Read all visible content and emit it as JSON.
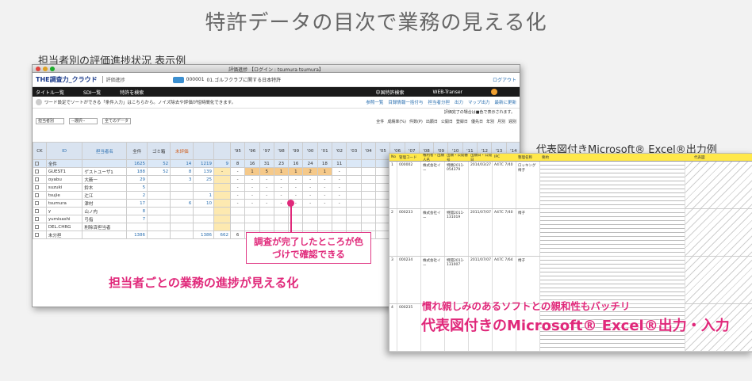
{
  "banner": {
    "title": "特許データの目次で業務の見える化",
    "left_caption": "担当者別の評価進捗状況 表示例",
    "right_caption": "代表図付きMicrosoft® Excel®出力例"
  },
  "window": {
    "title": "評価進捗 【ログイン : tsumura tsumura】",
    "app_logo": "THE調査力_クラウド",
    "page_name": "評価進捗",
    "project_id": "000001",
    "project_name": "01.ゴルフクラブに関する日本特許",
    "logout": "ログアウト"
  },
  "nav": {
    "items": [
      "タイトル一覧",
      "SDI一覧",
      "特許を検索"
    ],
    "right": [
      "中国特許検索",
      "WEB-Transer"
    ]
  },
  "toolbar": {
    "info": "ワード設定でソートができる「条件入力」はこちらから。ノイズ除去や評価が短時間化できます。",
    "tools": [
      "参照一覧",
      "目録情報一括付与",
      "担当者分担",
      "出力",
      "マップ出力",
      "最新に更新"
    ]
  },
  "hint": "評価完了の場合は■色で表示されます。",
  "filters": {
    "s1": "担当者別",
    "s2": "--選択--",
    "s3": "全てのデータ",
    "radios": [
      "全件",
      "成績率(%)",
      "件数(P)",
      "出願日",
      "公開日",
      "登録日",
      "優先日",
      "年別",
      "月別",
      "週別"
    ]
  },
  "table": {
    "headers": [
      "CK",
      "ID",
      "担当者名",
      "全件",
      "ゴミ箱",
      "未評価",
      "",
      "",
      "'95",
      "'96",
      "'97",
      "'98",
      "'99",
      "'00",
      "'01",
      "'02",
      "'03",
      "'04",
      "'05",
      "'06",
      "'07",
      "'08",
      "'09",
      "'10",
      "'11",
      "'12",
      "'13",
      "'14"
    ],
    "rows": [
      [
        "",
        "全件",
        "",
        "1625",
        "52",
        "14",
        "1219",
        "9",
        "8",
        "16",
        "31",
        "23",
        "16",
        "24",
        "18",
        "11",
        "",
        "",
        "",
        "",
        "",
        "",
        "",
        "",
        "",
        "",
        "",
        ""
      ],
      [
        "",
        "GUEST1",
        "ゲストユーザ1",
        "188",
        "52",
        "8",
        "139",
        "-",
        "-",
        "1",
        "5",
        "1",
        "1",
        "2",
        "1",
        "-",
        "",
        "",
        "",
        "",
        "",
        "",
        "",
        "",
        "",
        "",
        "",
        ""
      ],
      [
        "",
        "oyabu",
        "大薮一",
        "29",
        "",
        "3",
        "25",
        "",
        "-",
        "-",
        "-",
        "-",
        "-",
        "-",
        "-",
        "-",
        "",
        "",
        "",
        "",
        "",
        "",
        "",
        "",
        "",
        "",
        "",
        ""
      ],
      [
        "",
        "suzuki",
        "鈴木",
        "5",
        "",
        "",
        "",
        "",
        "-",
        "-",
        "-",
        "-",
        "-",
        "-",
        "-",
        "-",
        "",
        "",
        "",
        "",
        "",
        "",
        "",
        "",
        "",
        "",
        "",
        ""
      ],
      [
        "",
        "tsujie",
        "辻江",
        "2",
        "",
        "",
        "1",
        "",
        "-",
        "-",
        "-",
        "-",
        "-",
        "-",
        "-",
        "-",
        "",
        "",
        "",
        "",
        "",
        "",
        "",
        "",
        "",
        "",
        "",
        ""
      ],
      [
        "",
        "tsumura",
        "津村",
        "17",
        "",
        "6",
        "10",
        "",
        "-",
        "-",
        "-",
        "-",
        "-",
        "-",
        "-",
        "-",
        "",
        "",
        "",
        "",
        "",
        "",
        "",
        "",
        "",
        "",
        "",
        ""
      ],
      [
        "",
        "y",
        "山ノ内",
        "8",
        "",
        "",
        "",
        "",
        "",
        "",
        "",
        "",
        "",
        "",
        "",
        "",
        "",
        "",
        "",
        "",
        "",
        "",
        "",
        "",
        "",
        "",
        "",
        ""
      ],
      [
        "",
        "yumisashi",
        "弓指",
        "7",
        "",
        "",
        "",
        "",
        "",
        "",
        "",
        "",
        "",
        "",
        "",
        "",
        "",
        "",
        "",
        "",
        "",
        "",
        "",
        "",
        "",
        "",
        "",
        ""
      ],
      [
        "",
        "DEL.CHRG",
        "削除済担当者",
        "",
        "",
        "",
        "",
        "",
        "",
        "",
        "",
        "",
        "",
        "",
        "",
        "",
        "",
        "",
        "",
        "",
        "",
        "",
        "",
        "",
        "",
        "",
        "",
        ""
      ],
      [
        "",
        "未分担",
        "",
        "1386",
        "",
        "",
        "1386",
        "662",
        "6",
        "",
        "",
        "",
        "",
        "",
        "",
        "",
        "",
        "",
        "",
        "",
        "",
        "",
        "",
        "",
        "",
        "",
        "",
        ""
      ]
    ]
  },
  "callout": "調査が完了したところが色づけで確認できる",
  "pink_caption": "担当者ごとの業務の進捗が見える化",
  "excel": {
    "headers": [
      "No",
      "管理コード",
      "権利者・出願人名",
      "出願・公開番号",
      "出願日・公開日",
      "IPC",
      "整理名称",
      "要約",
      "代表図"
    ],
    "rows": [
      [
        "1",
        "000002",
        "株式会社イー",
        "特願2011-054379",
        "2014/03/27",
        "A47C 7/40",
        "ロッキング椅子"
      ],
      [
        "2",
        "000233",
        "株式会社イー",
        "特開2011-131019",
        "2011/07/07",
        "A47C 7/40",
        "椅子"
      ],
      [
        "3",
        "000234",
        "株式会社イー",
        "特開2011-131007",
        "2011/07/07",
        "A47C 7/64",
        "椅子"
      ],
      [
        "4",
        "000235",
        "",
        "",
        "",
        "",
        ""
      ]
    ]
  },
  "pink2": "慣れ親しみのあるソフトとの親和性もバッチリ",
  "pink3": "代表図付きのMicrosoft® Excel®出力・入力"
}
